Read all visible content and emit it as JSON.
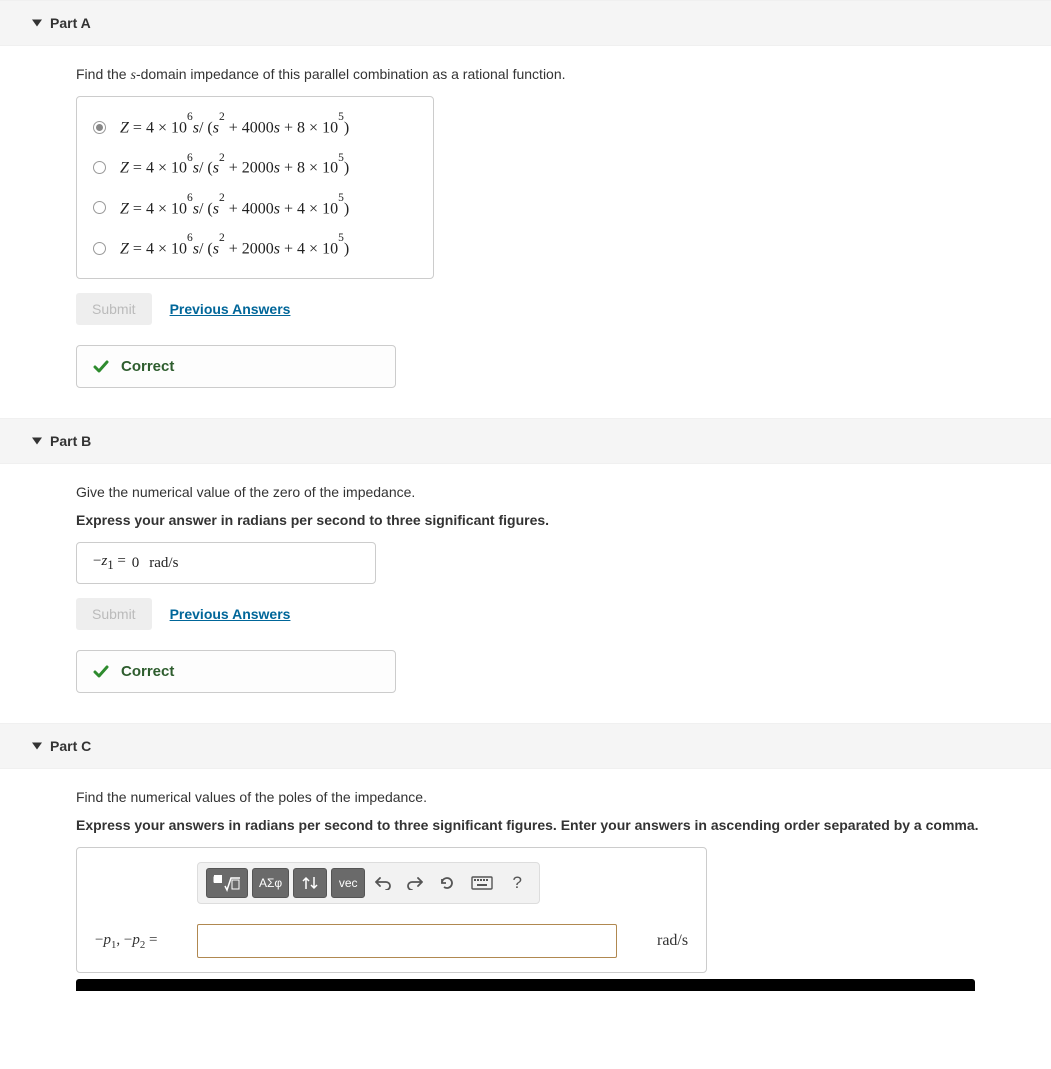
{
  "parts": {
    "a": {
      "title": "Part A",
      "prompt_pre": "Find the ",
      "prompt_var": "s",
      "prompt_post": "-domain impedance of this parallel combination as a rational function.",
      "options": [
        {
          "selected": true,
          "Z": "Z",
          "coef": "4 × 10",
          "coef_exp": "6",
          "s": "s",
          "den_s2": "s",
          "den_s2_exp": "2",
          "mid": " + 4000",
          "mid_s": "s",
          "end": " + 8 × 10",
          "end_exp": "5"
        },
        {
          "selected": false,
          "Z": "Z",
          "coef": "4 × 10",
          "coef_exp": "6",
          "s": "s",
          "den_s2": "s",
          "den_s2_exp": "2",
          "mid": " + 2000",
          "mid_s": "s",
          "end": " + 8 × 10",
          "end_exp": "5"
        },
        {
          "selected": false,
          "Z": "Z",
          "coef": "4 × 10",
          "coef_exp": "6",
          "s": "s",
          "den_s2": "s",
          "den_s2_exp": "2",
          "mid": " + 4000",
          "mid_s": "s",
          "end": " + 4 × 10",
          "end_exp": "5"
        },
        {
          "selected": false,
          "Z": "Z",
          "coef": "4 × 10",
          "coef_exp": "6",
          "s": "s",
          "den_s2": "s",
          "den_s2_exp": "2",
          "mid": " + 2000",
          "mid_s": "s",
          "end": " + 4 × 10",
          "end_exp": "5"
        }
      ],
      "submit": "Submit",
      "prev": "Previous Answers",
      "feedback": "Correct"
    },
    "b": {
      "title": "Part B",
      "prompt": "Give the numerical value of the zero of the impedance.",
      "instruct": "Express your answer in radians per second to three significant figures.",
      "ans_lhs_minus": "−",
      "ans_lhs_var": "z",
      "ans_lhs_sub": "1",
      "ans_eq": " = ",
      "ans_val": "0",
      "ans_unit": "rad/s",
      "submit": "Submit",
      "prev": "Previous Answers",
      "feedback": "Correct"
    },
    "c": {
      "title": "Part C",
      "prompt": "Find the numerical values of the poles of the impedance.",
      "instruct": "Express your answers in radians per second to three significant figures. Enter your answers in ascending order separated by a comma.",
      "toolbar": {
        "greek": "ΑΣφ",
        "vec": "vec",
        "help": "?"
      },
      "lhs_minus1": "−",
      "lhs_p": "p",
      "lhs_sub1": "1",
      "lhs_comma": ", ",
      "lhs_minus2": "−",
      "lhs_p2": "p",
      "lhs_sub2": "2",
      "lhs_eq": " =",
      "input_value": "",
      "unit": "rad/s"
    }
  }
}
